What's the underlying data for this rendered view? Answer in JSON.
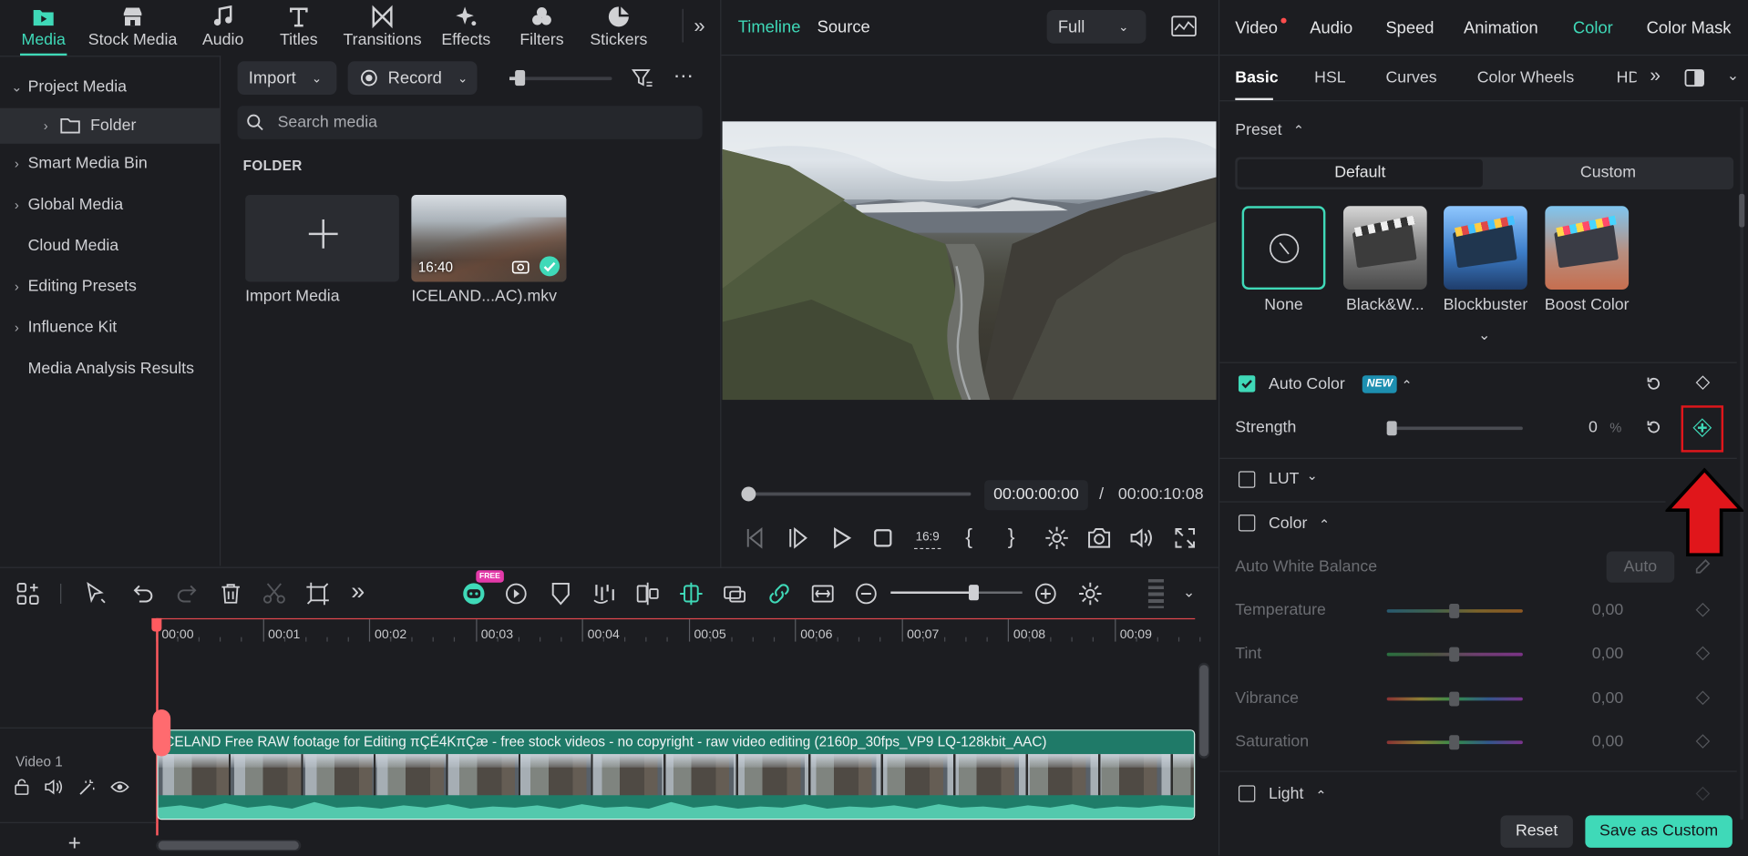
{
  "top_tabs": [
    {
      "label": "Media",
      "icon": "media-folder-icon",
      "active": true
    },
    {
      "label": "Stock Media",
      "icon": "store-icon"
    },
    {
      "label": "Audio",
      "icon": "music-note-icon"
    },
    {
      "label": "Titles",
      "icon": "title-t-icon"
    },
    {
      "label": "Transitions",
      "icon": "bowtie-icon"
    },
    {
      "label": "Effects",
      "icon": "sparkle-icon"
    },
    {
      "label": "Filters",
      "icon": "filter-circles-icon"
    },
    {
      "label": "Stickers",
      "icon": "sticker-icon"
    }
  ],
  "sidebar": {
    "items": [
      {
        "label": "Project Media",
        "expand": "v"
      },
      {
        "label": "Folder",
        "expand": ">"
      },
      {
        "label": "Smart Media Bin",
        "expand": ">"
      },
      {
        "label": "Global Media",
        "expand": ">"
      },
      {
        "label": "Cloud Media",
        "expand": ""
      },
      {
        "label": "Editing Presets",
        "expand": ">"
      },
      {
        "label": "Influence Kit",
        "expand": ">"
      },
      {
        "label": "Media Analysis Results",
        "expand": ""
      }
    ]
  },
  "media_toolbar": {
    "import_label": "Import",
    "record_label": "Record",
    "search_placeholder": "Search media"
  },
  "media_panel": {
    "section_title": "FOLDER",
    "import_label": "Import Media",
    "clip": {
      "name": "ICELAND...AC).mkv",
      "duration": "16:40"
    }
  },
  "preview": {
    "tab_timeline": "Timeline",
    "tab_source": "Source",
    "quality": "Full",
    "current_time": "00:00:00:00",
    "separator": "/",
    "total_time": "00:00:10:08",
    "aspect_label": "16:9",
    "bracket_in": "{",
    "bracket_out": "}"
  },
  "right_panel": {
    "tabs": [
      "Video",
      "Audio",
      "Speed",
      "Animation",
      "Color",
      "Color Mask"
    ],
    "active_tab": "Color",
    "subtabs": [
      "Basic",
      "HSL",
      "Curves",
      "Color Wheels",
      "HD"
    ],
    "active_subtab": "Basic",
    "preset_label": "Preset",
    "preset_default": "Default",
    "preset_custom": "Custom",
    "presets": [
      "None",
      "Black&W...",
      "Blockbuster",
      "Boost Color"
    ],
    "auto_color_label": "Auto Color",
    "new_badge": "NEW",
    "strength_label": "Strength",
    "strength_value": "0",
    "strength_unit": "%",
    "lut_label": "LUT",
    "color_label": "Color",
    "awb_label": "Auto White Balance",
    "awb_button": "Auto",
    "adjustments": [
      {
        "label": "Temperature",
        "value": "0,00"
      },
      {
        "label": "Tint",
        "value": "0,00"
      },
      {
        "label": "Vibrance",
        "value": "0,00"
      },
      {
        "label": "Saturation",
        "value": "0,00"
      }
    ],
    "light_label": "Light",
    "reset_label": "Reset",
    "save_custom_label": "Save as Custom"
  },
  "timeline": {
    "ruler": [
      "00:00",
      "00:01",
      "00:02",
      "00:03",
      "00:04",
      "00:05",
      "00:06",
      "00:07",
      "00:08",
      "00:09"
    ],
    "track_label": "Video 1",
    "clip_title": "ICELAND Free RAW footage for Editing πÇÉ4KπÇæ  - free stock videos - no copyright - raw video editing (2160p_30fps_VP9 LQ-128kbit_AAC)",
    "free_badge": "FREE"
  },
  "colors": {
    "accent": "#3fd9b8",
    "highlight_red": "#e0161b",
    "bg": "#1c1d21"
  }
}
